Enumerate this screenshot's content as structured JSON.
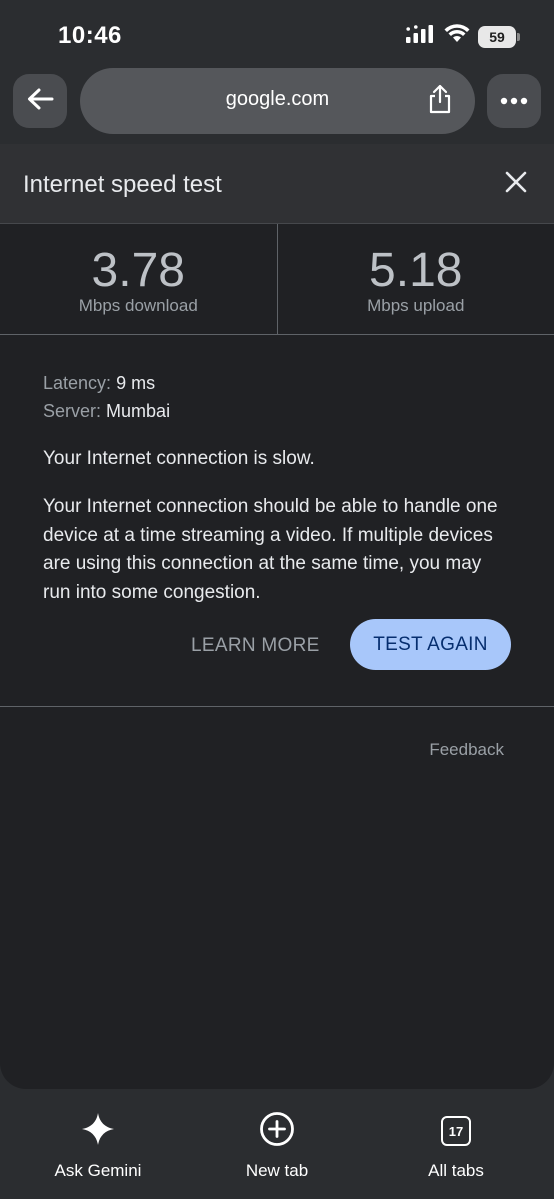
{
  "status_bar": {
    "time": "10:46",
    "battery": "59"
  },
  "toolbar": {
    "url": "google.com",
    "back_icon": "arrow-left-icon",
    "share_icon": "share-icon",
    "more_icon": "more-horizontal-icon"
  },
  "card": {
    "title": "Internet speed test",
    "download": {
      "value": "3.78",
      "label": "Mbps download"
    },
    "upload": {
      "value": "5.18",
      "label": "Mbps upload"
    },
    "latency": {
      "key": "Latency:",
      "value": "9 ms"
    },
    "server": {
      "key": "Server:",
      "value": "Mumbai"
    },
    "summary": "Your Internet connection is slow.",
    "description": "Your Internet connection should be able to handle one device at a time streaming a video. If multiple devices are using this connection at the same time, you may run into some congestion.",
    "learn_more": "LEARN MORE",
    "test_again": "TEST AGAIN",
    "feedback": "Feedback"
  },
  "bottom_nav": {
    "ask_gemini": "Ask Gemini",
    "new_tab": "New tab",
    "all_tabs": "All tabs",
    "tab_count": "17"
  },
  "colors": {
    "accent_button": "#a8c7fa",
    "background": "#202124"
  }
}
